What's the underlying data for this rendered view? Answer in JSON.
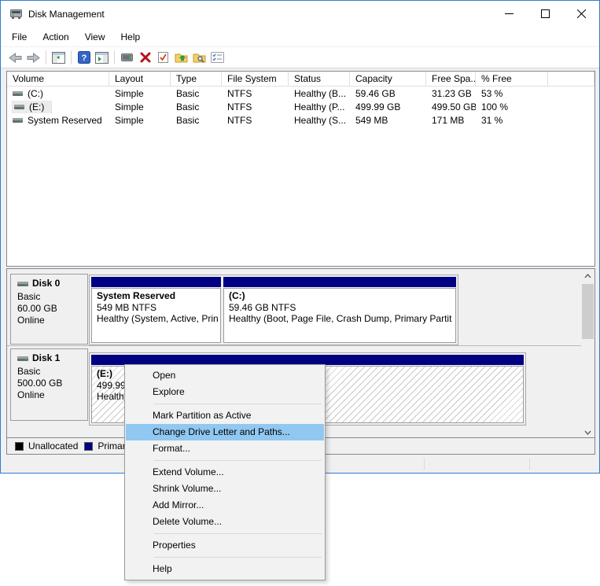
{
  "window": {
    "title": "Disk Management",
    "controls": {
      "minimize": "minimize",
      "maximize": "maximize",
      "close": "close"
    }
  },
  "menubar": [
    "File",
    "Action",
    "View",
    "Help"
  ],
  "toolbar_icons": [
    "back",
    "forward",
    "show-console-tree",
    "help",
    "show-action-pane",
    "console-window",
    "delete-volume",
    "set-mark",
    "open-folder",
    "explore-folder",
    "properties-list"
  ],
  "volume_list": {
    "columns": [
      "Volume",
      "Layout",
      "Type",
      "File System",
      "Status",
      "Capacity",
      "Free Spa...",
      "% Free"
    ],
    "rows": [
      {
        "volume": "(C:)",
        "layout": "Simple",
        "type": "Basic",
        "fs": "NTFS",
        "status": "Healthy (B...",
        "capacity": "59.46 GB",
        "free": "31.23 GB",
        "pct": "53 %"
      },
      {
        "volume": "(E:)",
        "layout": "Simple",
        "type": "Basic",
        "fs": "NTFS",
        "status": "Healthy (P...",
        "capacity": "499.99 GB",
        "free": "499.50 GB",
        "pct": "100 %"
      },
      {
        "volume": "System Reserved",
        "layout": "Simple",
        "type": "Basic",
        "fs": "NTFS",
        "status": "Healthy (S...",
        "capacity": "549 MB",
        "free": "171 MB",
        "pct": "31 %"
      }
    ]
  },
  "disks": [
    {
      "name": "Disk 0",
      "type": "Basic",
      "size": "60.00 GB",
      "status": "Online",
      "partitions": [
        {
          "name": "System Reserved",
          "size_fs": "549 MB NTFS",
          "health": "Healthy (System, Active, Prin"
        },
        {
          "name": "(C:)",
          "size_fs": "59.46 GB NTFS",
          "health": "Healthy (Boot, Page File, Crash Dump, Primary Partit"
        }
      ]
    },
    {
      "name": "Disk 1",
      "type": "Basic",
      "size": "500.00 GB",
      "status": "Online",
      "partitions": [
        {
          "name": "(E:)",
          "size_fs": "499.99 GB NTFS",
          "health": "Healthy (Primary Partition)"
        }
      ]
    }
  ],
  "legend": {
    "items": [
      {
        "label": "Unallocated",
        "color": "#000000"
      },
      {
        "label": "Primary partition",
        "color": "#000082"
      }
    ]
  },
  "context_menu": {
    "items": [
      {
        "label": "Open"
      },
      {
        "label": "Explore"
      },
      {
        "separator": true
      },
      {
        "label": "Mark Partition as Active"
      },
      {
        "label": "Change Drive Letter and Paths...",
        "highlighted": true
      },
      {
        "label": "Format..."
      },
      {
        "separator": true
      },
      {
        "label": "Extend Volume..."
      },
      {
        "label": "Shrink Volume..."
      },
      {
        "label": "Add Mirror..."
      },
      {
        "label": "Delete Volume..."
      },
      {
        "separator": true
      },
      {
        "label": "Properties"
      },
      {
        "separator": true
      },
      {
        "label": "Help"
      }
    ]
  },
  "colors": {
    "window_border": "#2e7dd2",
    "partition_bar": "#000082",
    "menu_highlight": "#91c8f2",
    "pane_border": "#828790"
  }
}
